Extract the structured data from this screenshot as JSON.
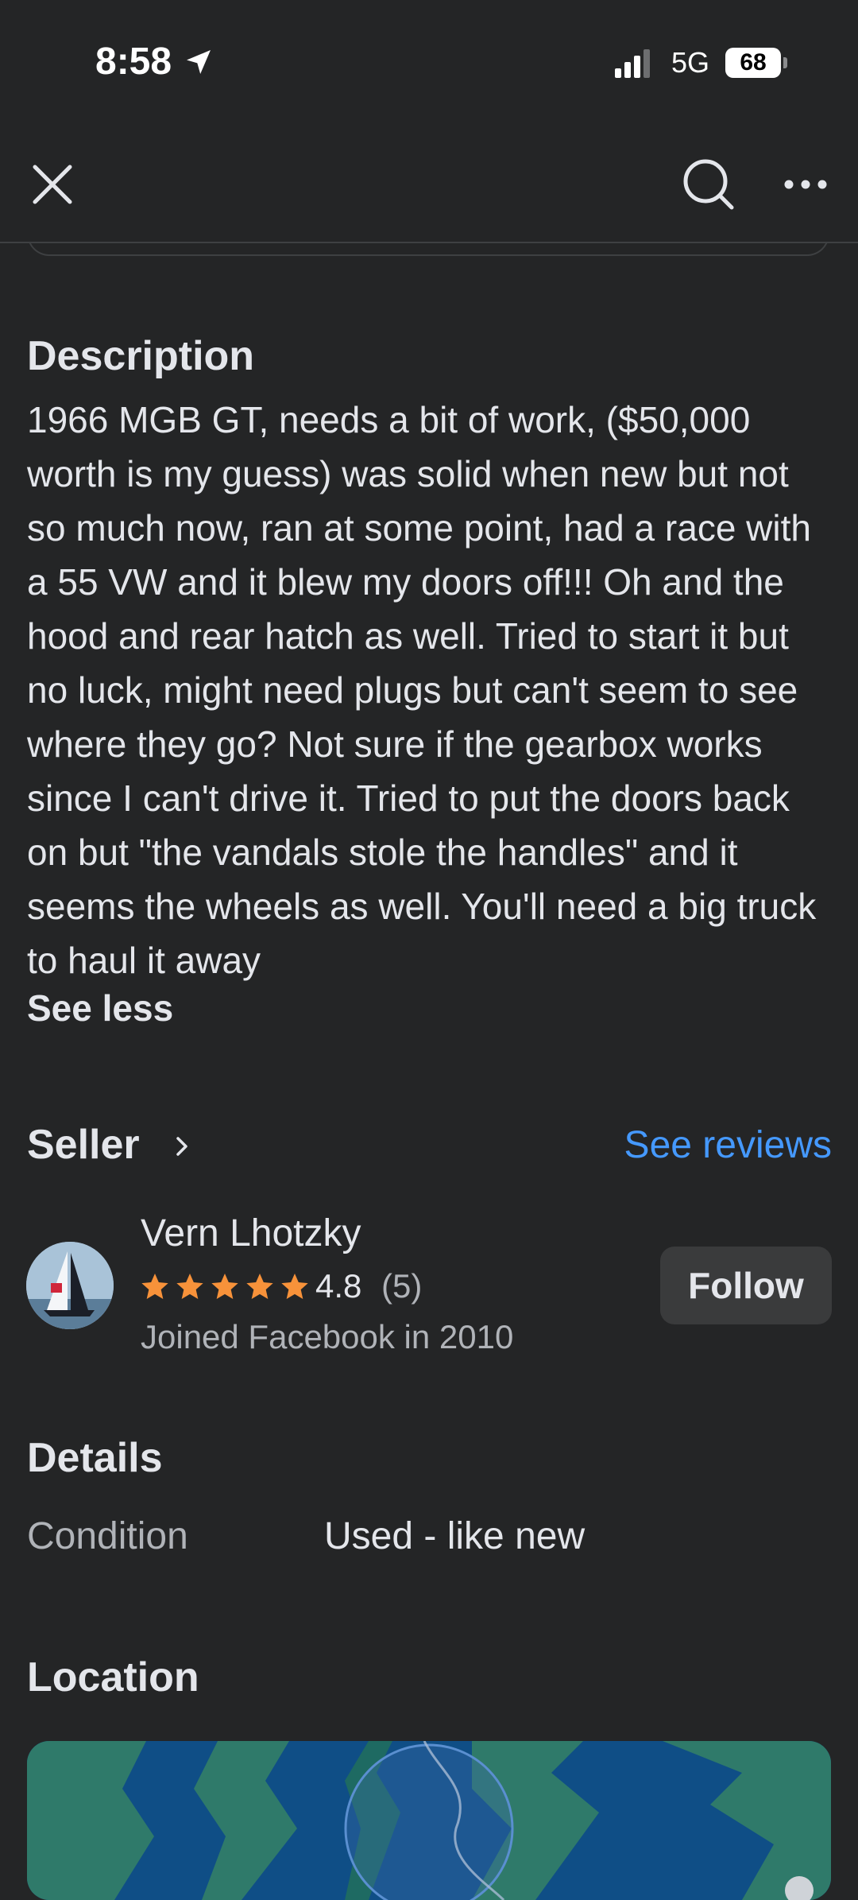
{
  "status_bar": {
    "time": "8:58",
    "network": "5G",
    "battery": "68"
  },
  "nav": {
    "close_icon": "close-icon",
    "search_icon": "search-icon",
    "more_icon": "more-horizontal-icon"
  },
  "description": {
    "title": "Description",
    "text": "1966 MGB GT, needs a bit of work, ($50,000 worth is my guess) was solid when new but not so much now, ran at some point, had a race with a 55 VW and it blew my doors off!!! Oh and the hood and rear hatch as well. Tried to start it but no luck, might need plugs but can't seem to see where they go? Not sure if the gearbox works since I can't drive it. Tried to put the doors back on but \"the vandals stole the handles\" and it seems the wheels as well. You'll need a big truck to haul it away",
    "toggle_label": "See less"
  },
  "seller": {
    "title": "Seller",
    "reviews_link": "See reviews",
    "name": "Vern Lhotzky",
    "stars": 5,
    "rating": "4.8",
    "rating_count": "(5)",
    "joined": "Joined Facebook in 2010",
    "follow_label": "Follow"
  },
  "details": {
    "title": "Details",
    "rows": [
      {
        "label": "Condition",
        "value": "Used - like new"
      }
    ]
  },
  "location": {
    "title": "Location"
  },
  "colors": {
    "background": "#242526",
    "accent_link": "#4599ff",
    "star": "#f7923a",
    "secondary_text": "#b0b3b8",
    "button_bg": "#3a3b3c"
  }
}
